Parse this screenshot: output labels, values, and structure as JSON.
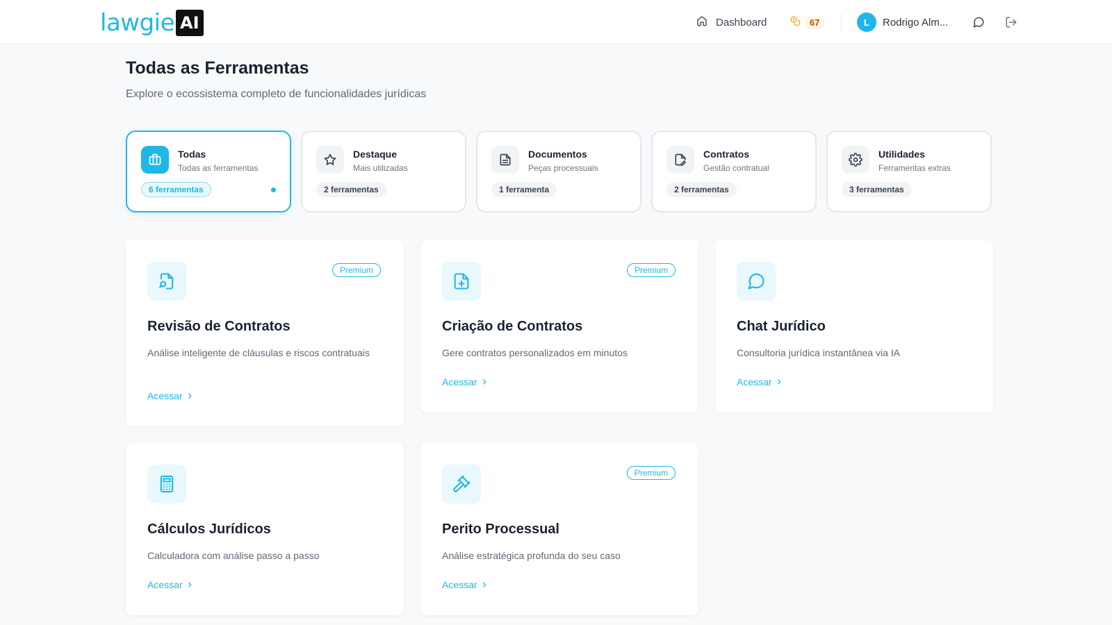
{
  "brand": {
    "name": "lawgie",
    "badge": "AI",
    "color": "#22b8e0"
  },
  "header": {
    "dashboard_label": "Dashboard",
    "credits": "67",
    "user_initial": "L",
    "user_name": "Rodrigo Alm...",
    "icons": [
      "home-icon",
      "coins-icon",
      "chat-icon",
      "logout-icon"
    ]
  },
  "page": {
    "title": "Todas as Ferramentas",
    "subtitle": "Explore o ecossistema completo de funcionalidades jurídicas"
  },
  "categories": [
    {
      "name": "Todas",
      "desc": "Todas as ferramentas",
      "count": "6 ferramentas",
      "icon": "briefcase-icon",
      "active": true
    },
    {
      "name": "Destaque",
      "desc": "Mais utilizadas",
      "count": "2 ferramentas",
      "icon": "star-icon",
      "active": false
    },
    {
      "name": "Documentos",
      "desc": "Peças processuais",
      "count": "1 ferramenta",
      "icon": "document-icon",
      "active": false
    },
    {
      "name": "Contratos",
      "desc": "Gestão contratual",
      "count": "2 ferramentas",
      "icon": "file-edit-icon",
      "active": false
    },
    {
      "name": "Utilidades",
      "desc": "Ferramentas extras",
      "count": "3 ferramentas",
      "icon": "gear-icon",
      "active": false
    }
  ],
  "tools": [
    {
      "title": "Revisão de Contratos",
      "desc": "Análise inteligente de cláusulas e riscos contratuais",
      "badge": "Premium",
      "link": "Acessar",
      "icon": "file-search-icon"
    },
    {
      "title": "Criação de Contratos",
      "desc": "Gere contratos personalizados em minutos",
      "badge": "Premium",
      "link": "Acessar",
      "icon": "file-plus-icon"
    },
    {
      "title": "Chat Jurídico",
      "desc": "Consultoria jurídica instantânea via IA",
      "badge": "",
      "link": "Acessar",
      "icon": "chat-bubble-icon"
    },
    {
      "title": "Cálculos Jurídicos",
      "desc": "Calculadora com análise passo a passo",
      "badge": "",
      "link": "Acessar",
      "icon": "calculator-icon"
    },
    {
      "title": "Perito Processual",
      "desc": "Análise estratégica profunda do seu caso",
      "badge": "Premium",
      "link": "Acessar",
      "icon": "gavel-icon"
    }
  ],
  "colors": {
    "accent": "#1fb6e8",
    "credits": "#f5a623"
  }
}
